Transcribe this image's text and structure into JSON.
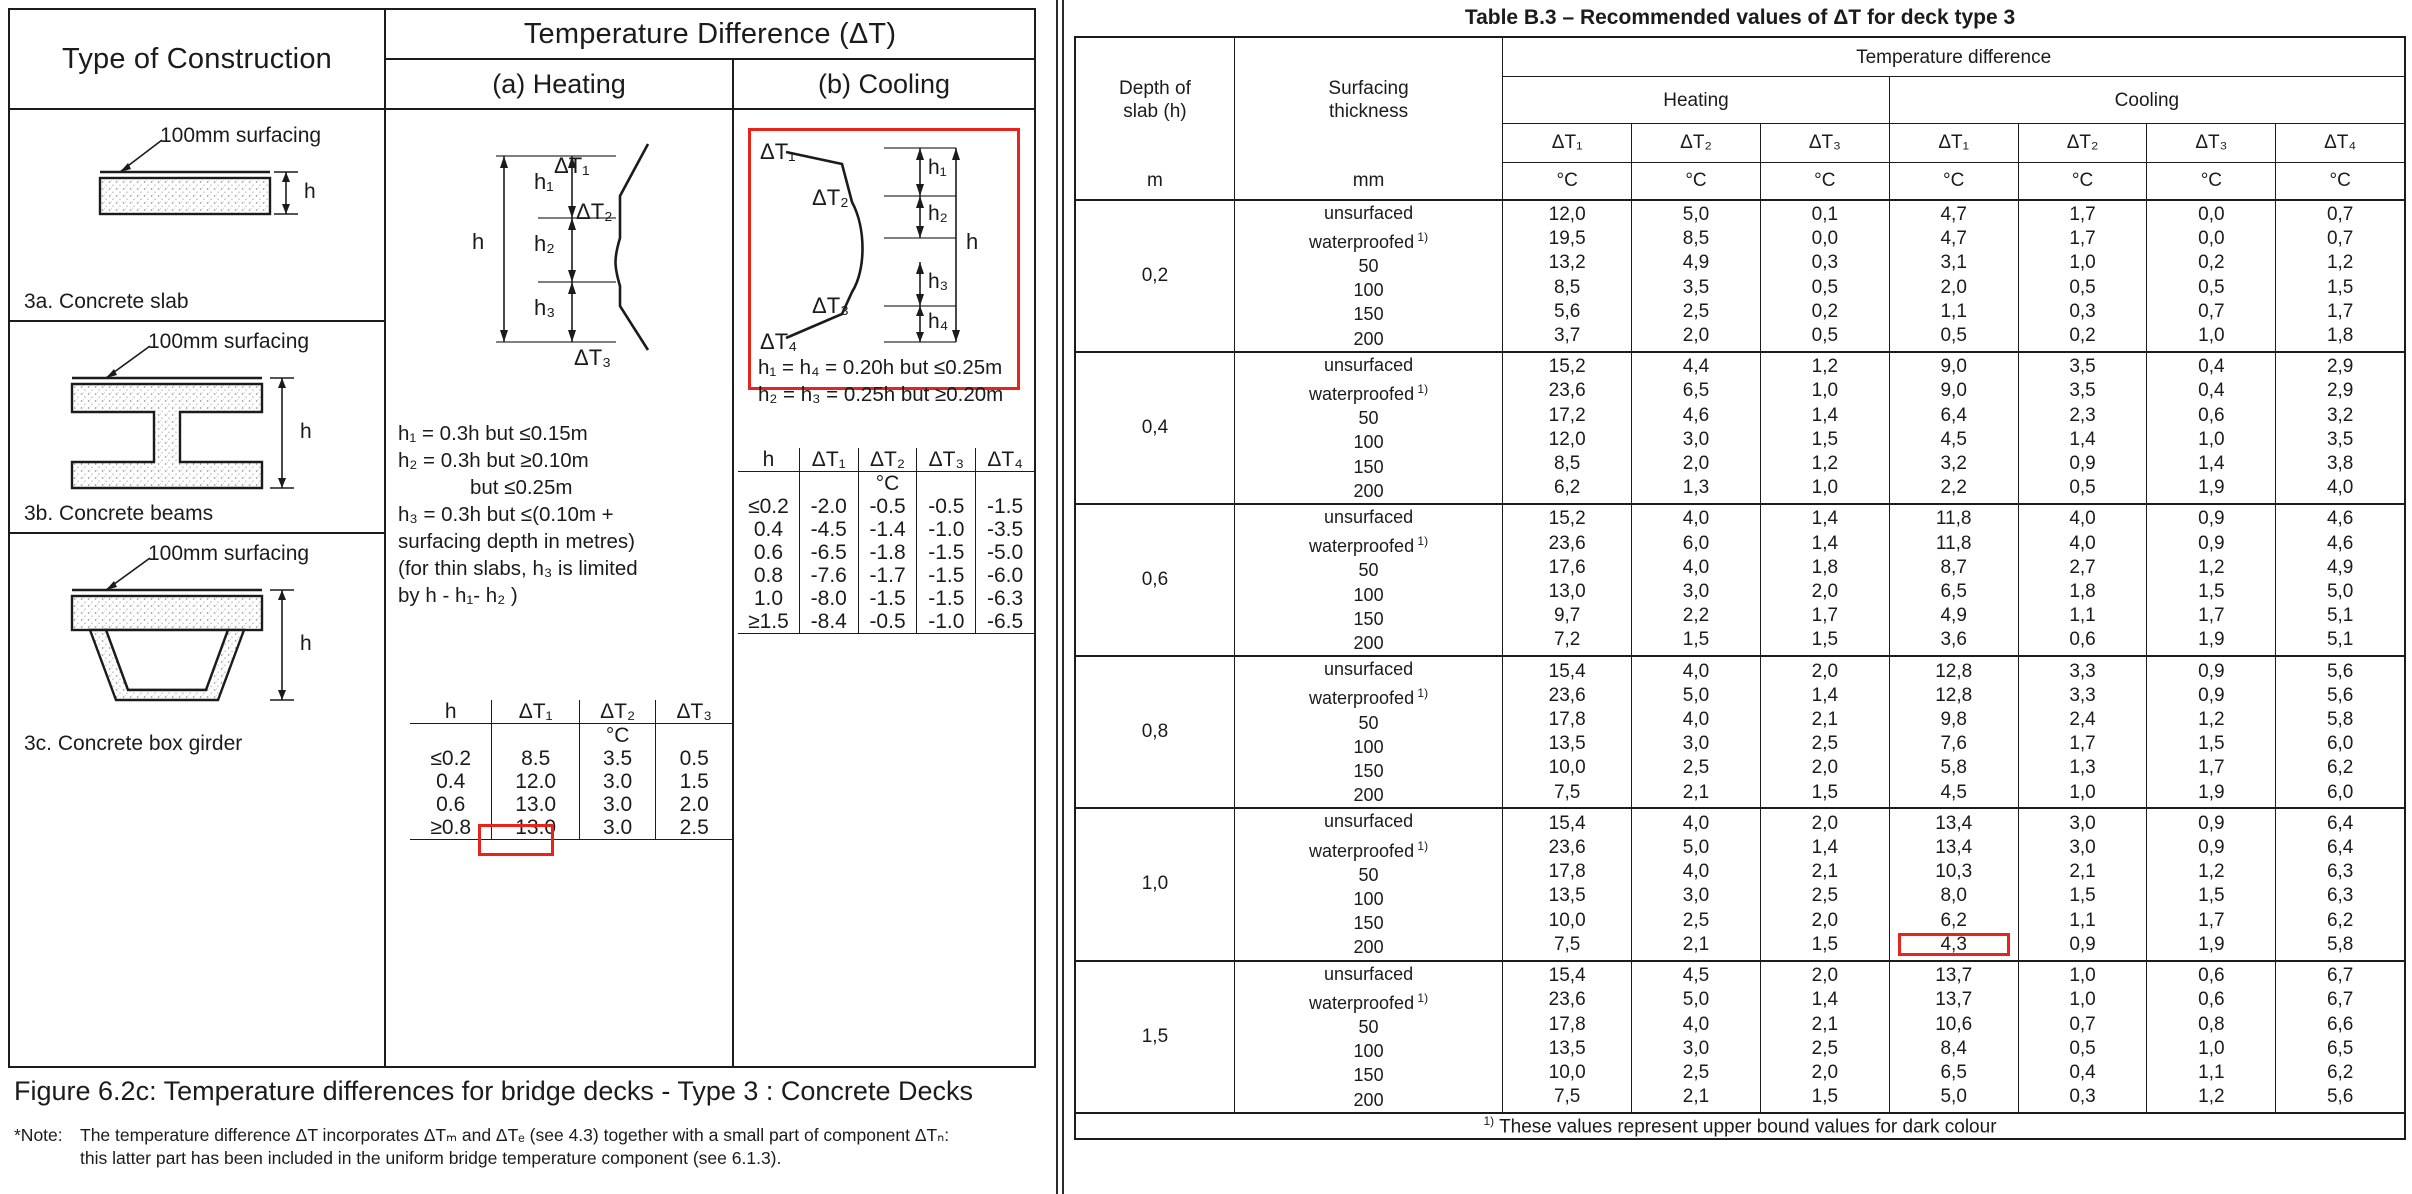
{
  "figure": {
    "headers": {
      "type_of_construction": "Type of Construction",
      "temperature_difference": "Temperature Difference (ΔT)",
      "heating": "(a) Heating",
      "cooling": "(b) Cooling"
    },
    "constructions": [
      {
        "label": "3a. Concrete slab",
        "callout": "100mm surfacing",
        "depth_label": "h"
      },
      {
        "label": "3b. Concrete beams",
        "callout": "100mm surfacing",
        "depth_label": "h"
      },
      {
        "label": "3c. Concrete box girder",
        "callout": "100mm surfacing",
        "depth_label": "h"
      }
    ],
    "heating_diagram": {
      "labels": [
        "ΔT₁",
        "ΔT₂",
        "ΔT₃"
      ],
      "dims": [
        "h₁",
        "h₂",
        "h₃",
        "h"
      ]
    },
    "cooling_diagram": {
      "labels": [
        "ΔT₁",
        "ΔT₂",
        "ΔT₃",
        "ΔT₄"
      ],
      "dims": [
        "h₁",
        "h₂",
        "h₃",
        "h₄",
        "h"
      ]
    },
    "heating_notes": [
      "h₁ = 0.3h but ≤0.15m",
      "h₂ = 0.3h but ≥0.10m",
      "but ≤0.25m",
      "h₃ = 0.3h but ≤(0.10m +",
      "surfacing depth in metres)",
      "(for thin slabs, h₃ is limited",
      "by h - h₁- h₂ )"
    ],
    "cooling_notes": [
      "h₁ = h₄ = 0.20h but ≤0.25m",
      "h₂ = h₃ = 0.25h but ≥0.20m"
    ],
    "heating_table": {
      "columns": [
        "h",
        "ΔT₁",
        "ΔT₂",
        "ΔT₃"
      ],
      "unit_row": [
        "",
        "",
        "°C",
        ""
      ],
      "rows": [
        [
          "≤0.2",
          "8.5",
          "3.5",
          "0.5"
        ],
        [
          "0.4",
          "12.0",
          "3.0",
          "1.5"
        ],
        [
          "0.6",
          "13.0",
          "3.0",
          "2.0"
        ],
        [
          "≥0.8",
          "13.0",
          "3.0",
          "2.5"
        ]
      ],
      "highlight": {
        "row": 3,
        "col": 1
      }
    },
    "cooling_table": {
      "columns": [
        "h",
        "ΔT₁",
        "ΔT₂",
        "ΔT₃",
        "ΔT₄"
      ],
      "unit_row": [
        "",
        "",
        "°C",
        "",
        ""
      ],
      "rows": [
        [
          "≤0.2",
          "-2.0",
          "-0.5",
          "-0.5",
          "-1.5"
        ],
        [
          "0.4",
          "-4.5",
          "-1.4",
          "-1.0",
          "-3.5"
        ],
        [
          "0.6",
          "-6.5",
          "-1.8",
          "-1.5",
          "-5.0"
        ],
        [
          "0.8",
          "-7.6",
          "-1.7",
          "-1.5",
          "-6.0"
        ],
        [
          "1.0",
          "-8.0",
          "-1.5",
          "-1.5",
          "-6.3"
        ],
        [
          "≥1.5",
          "-8.4",
          "-0.5",
          "-1.0",
          "-6.5"
        ]
      ]
    },
    "caption": "Figure 6.2c: Temperature differences for bridge decks - Type 3 : Concrete Decks",
    "note_label": "*Note:",
    "note_line1": "The temperature difference ΔT incorporates ΔTₘ and ΔTₑ (see 4.3) together with a small part of component ΔTₙ:",
    "note_line2": "this latter part has been included in the uniform bridge temperature component (see 6.1.3)."
  },
  "table_b3": {
    "title": "Table B.3 – Recommended values of ΔT for deck type 3",
    "header": {
      "depth_of_slab": "Depth of\nslab (h)",
      "depth_line1": "Depth of",
      "depth_line2": "slab (h)",
      "surfacing_line1": "Surfacing",
      "surfacing_line2": "thickness",
      "temperature_difference": "Temperature difference",
      "heating": "Heating",
      "cooling": "Cooling",
      "dt_cols": [
        "ΔT₁",
        "ΔT₂",
        "ΔT₃",
        "ΔT₁",
        "ΔT₂",
        "ΔT₃",
        "ΔT₄"
      ],
      "unit_depth": "m",
      "unit_surfacing": "mm",
      "unit_temp": "°C"
    },
    "surfacing_labels": [
      "unsurfaced",
      "waterproofed",
      "50",
      "100",
      "150",
      "200"
    ],
    "waterproofed_sup": "1)",
    "groups": [
      {
        "depth": "0,2",
        "rows": [
          {
            "surfacing": "unsurfaced",
            "heating": [
              "12,0",
              "5,0",
              "0,1"
            ],
            "cooling": [
              "4,7",
              "1,7",
              "0,0",
              "0,7"
            ]
          },
          {
            "surfacing": "waterproofed",
            "heating": [
              "19,5",
              "8,5",
              "0,0"
            ],
            "cooling": [
              "4,7",
              "1,7",
              "0,0",
              "0,7"
            ]
          },
          {
            "surfacing": "50",
            "heating": [
              "13,2",
              "4,9",
              "0,3"
            ],
            "cooling": [
              "3,1",
              "1,0",
              "0,2",
              "1,2"
            ]
          },
          {
            "surfacing": "100",
            "heating": [
              "8,5",
              "3,5",
              "0,5"
            ],
            "cooling": [
              "2,0",
              "0,5",
              "0,5",
              "1,5"
            ]
          },
          {
            "surfacing": "150",
            "heating": [
              "5,6",
              "2,5",
              "0,2"
            ],
            "cooling": [
              "1,1",
              "0,3",
              "0,7",
              "1,7"
            ]
          },
          {
            "surfacing": "200",
            "heating": [
              "3,7",
              "2,0",
              "0,5"
            ],
            "cooling": [
              "0,5",
              "0,2",
              "1,0",
              "1,8"
            ]
          }
        ]
      },
      {
        "depth": "0,4",
        "rows": [
          {
            "surfacing": "unsurfaced",
            "heating": [
              "15,2",
              "4,4",
              "1,2"
            ],
            "cooling": [
              "9,0",
              "3,5",
              "0,4",
              "2,9"
            ]
          },
          {
            "surfacing": "waterproofed",
            "heating": [
              "23,6",
              "6,5",
              "1,0"
            ],
            "cooling": [
              "9,0",
              "3,5",
              "0,4",
              "2,9"
            ]
          },
          {
            "surfacing": "50",
            "heating": [
              "17,2",
              "4,6",
              "1,4"
            ],
            "cooling": [
              "6,4",
              "2,3",
              "0,6",
              "3,2"
            ]
          },
          {
            "surfacing": "100",
            "heating": [
              "12,0",
              "3,0",
              "1,5"
            ],
            "cooling": [
              "4,5",
              "1,4",
              "1,0",
              "3,5"
            ]
          },
          {
            "surfacing": "150",
            "heating": [
              "8,5",
              "2,0",
              "1,2"
            ],
            "cooling": [
              "3,2",
              "0,9",
              "1,4",
              "3,8"
            ]
          },
          {
            "surfacing": "200",
            "heating": [
              "6,2",
              "1,3",
              "1,0"
            ],
            "cooling": [
              "2,2",
              "0,5",
              "1,9",
              "4,0"
            ]
          }
        ]
      },
      {
        "depth": "0,6",
        "rows": [
          {
            "surfacing": "unsurfaced",
            "heating": [
              "15,2",
              "4,0",
              "1,4"
            ],
            "cooling": [
              "11,8",
              "4,0",
              "0,9",
              "4,6"
            ]
          },
          {
            "surfacing": "waterproofed",
            "heating": [
              "23,6",
              "6,0",
              "1,4"
            ],
            "cooling": [
              "11,8",
              "4,0",
              "0,9",
              "4,6"
            ]
          },
          {
            "surfacing": "50",
            "heating": [
              "17,6",
              "4,0",
              "1,8"
            ],
            "cooling": [
              "8,7",
              "2,7",
              "1,2",
              "4,9"
            ]
          },
          {
            "surfacing": "100",
            "heating": [
              "13,0",
              "3,0",
              "2,0"
            ],
            "cooling": [
              "6,5",
              "1,8",
              "1,5",
              "5,0"
            ]
          },
          {
            "surfacing": "150",
            "heating": [
              "9,7",
              "2,2",
              "1,7"
            ],
            "cooling": [
              "4,9",
              "1,1",
              "1,7",
              "5,1"
            ]
          },
          {
            "surfacing": "200",
            "heating": [
              "7,2",
              "1,5",
              "1,5"
            ],
            "cooling": [
              "3,6",
              "0,6",
              "1,9",
              "5,1"
            ]
          }
        ]
      },
      {
        "depth": "0,8",
        "rows": [
          {
            "surfacing": "unsurfaced",
            "heating": [
              "15,4",
              "4,0",
              "2,0"
            ],
            "cooling": [
              "12,8",
              "3,3",
              "0,9",
              "5,6"
            ]
          },
          {
            "surfacing": "waterproofed",
            "heating": [
              "23,6",
              "5,0",
              "1,4"
            ],
            "cooling": [
              "12,8",
              "3,3",
              "0,9",
              "5,6"
            ]
          },
          {
            "surfacing": "50",
            "heating": [
              "17,8",
              "4,0",
              "2,1"
            ],
            "cooling": [
              "9,8",
              "2,4",
              "1,2",
              "5,8"
            ]
          },
          {
            "surfacing": "100",
            "heating": [
              "13,5",
              "3,0",
              "2,5"
            ],
            "cooling": [
              "7,6",
              "1,7",
              "1,5",
              "6,0"
            ]
          },
          {
            "surfacing": "150",
            "heating": [
              "10,0",
              "2,5",
              "2,0"
            ],
            "cooling": [
              "5,8",
              "1,3",
              "1,7",
              "6,2"
            ]
          },
          {
            "surfacing": "200",
            "heating": [
              "7,5",
              "2,1",
              "1,5"
            ],
            "cooling": [
              "4,5",
              "1,0",
              "1,9",
              "6,0"
            ]
          }
        ]
      },
      {
        "depth": "1,0",
        "rows": [
          {
            "surfacing": "unsurfaced",
            "heating": [
              "15,4",
              "4,0",
              "2,0"
            ],
            "cooling": [
              "13,4",
              "3,0",
              "0,9",
              "6,4"
            ]
          },
          {
            "surfacing": "waterproofed",
            "heating": [
              "23,6",
              "5,0",
              "1,4"
            ],
            "cooling": [
              "13,4",
              "3,0",
              "0,9",
              "6,4"
            ]
          },
          {
            "surfacing": "50",
            "heating": [
              "17,8",
              "4,0",
              "2,1"
            ],
            "cooling": [
              "10,3",
              "2,1",
              "1,2",
              "6,3"
            ]
          },
          {
            "surfacing": "100",
            "heating": [
              "13,5",
              "3,0",
              "2,5"
            ],
            "cooling": [
              "8,0",
              "1,5",
              "1,5",
              "6,3"
            ]
          },
          {
            "surfacing": "150",
            "heating": [
              "10,0",
              "2,5",
              "2,0"
            ],
            "cooling": [
              "6,2",
              "1,1",
              "1,7",
              "6,2"
            ]
          },
          {
            "surfacing": "200",
            "heating": [
              "7,5",
              "2,1",
              "1,5"
            ],
            "cooling": [
              "4,3",
              "0,9",
              "1,9",
              "5,8"
            ],
            "highlight_cooling_col": 0
          }
        ]
      },
      {
        "depth": "1,5",
        "rows": [
          {
            "surfacing": "unsurfaced",
            "heating": [
              "15,4",
              "4,5",
              "2,0"
            ],
            "cooling": [
              "13,7",
              "1,0",
              "0,6",
              "6,7"
            ]
          },
          {
            "surfacing": "waterproofed",
            "heating": [
              "23,6",
              "5,0",
              "1,4"
            ],
            "cooling": [
              "13,7",
              "1,0",
              "0,6",
              "6,7"
            ]
          },
          {
            "surfacing": "50",
            "heating": [
              "17,8",
              "4,0",
              "2,1"
            ],
            "cooling": [
              "10,6",
              "0,7",
              "0,8",
              "6,6"
            ]
          },
          {
            "surfacing": "100",
            "heating": [
              "13,5",
              "3,0",
              "2,5"
            ],
            "cooling": [
              "8,4",
              "0,5",
              "1,0",
              "6,5"
            ]
          },
          {
            "surfacing": "150",
            "heating": [
              "10,0",
              "2,5",
              "2,0"
            ],
            "cooling": [
              "6,5",
              "0,4",
              "1,1",
              "6,2"
            ]
          },
          {
            "surfacing": "200",
            "heating": [
              "7,5",
              "2,1",
              "1,5"
            ],
            "cooling": [
              "5,0",
              "0,3",
              "1,2",
              "5,6"
            ]
          }
        ]
      }
    ],
    "footnote": "These values represent upper bound values for dark colour",
    "footnote_marker": "1)"
  },
  "colors": {
    "highlight": "#e8231a",
    "ink": "#1b1b1b",
    "hatch": "#d8d8d8"
  }
}
